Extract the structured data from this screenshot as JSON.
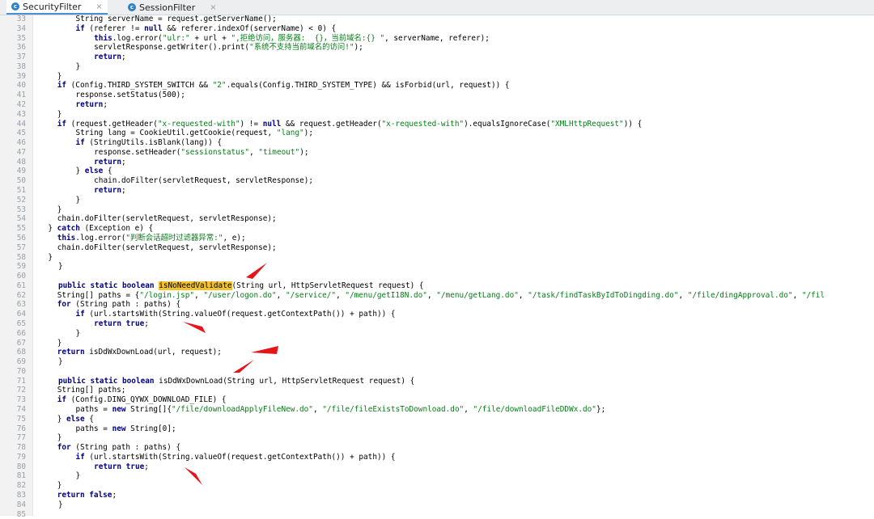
{
  "tabs": [
    {
      "label": "SecurityFilter",
      "icon": "class-icon",
      "close": "×"
    },
    {
      "label": "SessionFilter",
      "icon": "class-icon",
      "close": "×"
    }
  ],
  "lines": [
    {
      "n": "33",
      "i": 8,
      "t": [
        [
          "",
          "String serverName = request.getServerName();"
        ]
      ]
    },
    {
      "n": "34",
      "i": 8,
      "t": [
        [
          "kw",
          "if"
        ],
        [
          "",
          " (referer != "
        ],
        [
          "kw",
          "null"
        ],
        [
          "",
          " && referer.indexOf(serverName) < 0) {"
        ]
      ]
    },
    {
      "n": "35",
      "i": 12,
      "t": [
        [
          "kw",
          "this"
        ],
        [
          "",
          ".log.error("
        ],
        [
          "str",
          "\"ulr:\""
        ],
        [
          "",
          " + url + "
        ],
        [
          "str",
          "\",拒绝访问，服务器:  {}，当前域名:{} \""
        ],
        [
          "",
          ", serverName, referer);"
        ]
      ]
    },
    {
      "n": "36",
      "i": 12,
      "t": [
        [
          "",
          "servletResponse.getWriter().print("
        ],
        [
          "str",
          "\"系统不支持当前域名的访问!\""
        ],
        [
          "",
          ");"
        ]
      ]
    },
    {
      "n": "37",
      "i": 12,
      "t": [
        [
          "kw",
          "return"
        ],
        [
          "",
          ";"
        ]
      ]
    },
    {
      "n": "38",
      "i": 8,
      "t": [
        [
          "",
          "}"
        ]
      ]
    },
    {
      "n": "39",
      "i": 4,
      "t": [
        [
          "",
          "}"
        ]
      ]
    },
    {
      "n": "40",
      "i": 4,
      "t": [
        [
          "kw",
          "if"
        ],
        [
          "",
          " (Config.THIRD_SYSTEM_SWITCH && "
        ],
        [
          "str",
          "\"2\""
        ],
        [
          "",
          ".equals(Config.THIRD_SYSTEM_TYPE) && isForbid(url, request)) {"
        ]
      ]
    },
    {
      "n": "41",
      "i": 8,
      "t": [
        [
          "",
          "response.setStatus(500);"
        ]
      ]
    },
    {
      "n": "42",
      "i": 8,
      "t": [
        [
          "kw",
          "return"
        ],
        [
          "",
          ";"
        ]
      ]
    },
    {
      "n": "43",
      "i": 4,
      "t": [
        [
          "",
          "}"
        ]
      ]
    },
    {
      "n": "44",
      "i": 4,
      "t": [
        [
          "kw",
          "if"
        ],
        [
          "",
          " (request.getHeader("
        ],
        [
          "str",
          "\"x-requested-with\""
        ],
        [
          "",
          ") != "
        ],
        [
          "kw",
          "null"
        ],
        [
          "",
          " && request.getHeader("
        ],
        [
          "str",
          "\"x-requested-with\""
        ],
        [
          "",
          ").equalsIgnoreCase("
        ],
        [
          "str",
          "\"XMLHttpRequest\""
        ],
        [
          "",
          ")) {"
        ]
      ]
    },
    {
      "n": "45",
      "i": 8,
      "t": [
        [
          "",
          "String lang = CookieUtil.getCookie(request, "
        ],
        [
          "str",
          "\"lang\""
        ],
        [
          "",
          ");"
        ]
      ]
    },
    {
      "n": "46",
      "i": 8,
      "t": [
        [
          "kw",
          "if"
        ],
        [
          "",
          " (StringUtils.isBlank(lang)) {"
        ]
      ]
    },
    {
      "n": "47",
      "i": 12,
      "t": [
        [
          "",
          "response.setHeader("
        ],
        [
          "str",
          "\"sessionstatus\""
        ],
        [
          "",
          ", "
        ],
        [
          "str",
          "\"timeout\""
        ],
        [
          "",
          ");"
        ]
      ]
    },
    {
      "n": "48",
      "i": 12,
      "t": [
        [
          "kw",
          "return"
        ],
        [
          "",
          ";"
        ]
      ]
    },
    {
      "n": "49",
      "i": 8,
      "t": [
        [
          "",
          "} "
        ],
        [
          "kw",
          "else"
        ],
        [
          "",
          " {"
        ]
      ]
    },
    {
      "n": "50",
      "i": 12,
      "t": [
        [
          "",
          "chain.doFilter(servletRequest, servletResponse);"
        ]
      ]
    },
    {
      "n": "51",
      "i": 12,
      "t": [
        [
          "kw",
          "return"
        ],
        [
          "",
          ";"
        ]
      ]
    },
    {
      "n": "52",
      "i": 8,
      "t": [
        [
          "",
          "}"
        ]
      ]
    },
    {
      "n": "53",
      "i": 4,
      "t": [
        [
          "",
          "}"
        ]
      ]
    },
    {
      "n": "54",
      "i": 4,
      "t": [
        [
          "",
          "chain.doFilter(servletRequest, servletResponse);"
        ]
      ]
    },
    {
      "n": "55",
      "i": 2,
      "t": [
        [
          "",
          "} "
        ],
        [
          "kw",
          "catch"
        ],
        [
          "",
          " (Exception e) {"
        ]
      ]
    },
    {
      "n": "56",
      "i": 4,
      "t": [
        [
          "kw",
          "this"
        ],
        [
          "",
          ".log.error("
        ],
        [
          "str",
          "\"判断会话超时过滤器异常:\""
        ],
        [
          "",
          ", e);"
        ]
      ]
    },
    {
      "n": "57",
      "i": 4,
      "t": [
        [
          "",
          "chain.doFilter(servletRequest, servletResponse);"
        ]
      ]
    },
    {
      "n": "58",
      "i": 2,
      "t": [
        [
          "",
          "}"
        ]
      ]
    },
    {
      "n": "59",
      "i": 0,
      "t": [
        [
          "",
          "}"
        ]
      ]
    },
    {
      "n": "60",
      "i": 0,
      "t": []
    },
    {
      "n": "61",
      "i": 0,
      "t": [
        [
          "kw",
          "public static boolean"
        ],
        [
          "",
          " "
        ],
        [
          "hl",
          "isNoNeedValidate"
        ],
        [
          "",
          "(String url, HttpServletRequest request) {"
        ]
      ]
    },
    {
      "n": "62",
      "i": 4,
      "t": [
        [
          "",
          "String[] paths = {"
        ],
        [
          "str",
          "\"/login.jsp\""
        ],
        [
          "",
          ", "
        ],
        [
          "str",
          "\"/user/logon.do\""
        ],
        [
          "",
          ", "
        ],
        [
          "str",
          "\"/service/\""
        ],
        [
          "",
          ", "
        ],
        [
          "str",
          "\"/menu/getI18N.do\""
        ],
        [
          "",
          ", "
        ],
        [
          "str",
          "\"/menu/getLang.do\""
        ],
        [
          "",
          ", "
        ],
        [
          "str",
          "\"/task/findTaskByIdToDingding.do\""
        ],
        [
          "",
          ", "
        ],
        [
          "str",
          "\"/file/dingApproval.do\""
        ],
        [
          "",
          ", "
        ],
        [
          "str",
          "\"/fil"
        ]
      ]
    },
    {
      "n": "63",
      "i": 4,
      "t": [
        [
          "kw",
          "for"
        ],
        [
          "",
          " (String path : paths) {"
        ]
      ]
    },
    {
      "n": "64",
      "i": 8,
      "t": [
        [
          "kw",
          "if"
        ],
        [
          "",
          " (url.startsWith(String.valueOf(request.getContextPath()) + path)) {"
        ]
      ]
    },
    {
      "n": "65",
      "i": 12,
      "t": [
        [
          "kw",
          "return true"
        ],
        [
          "",
          ";"
        ]
      ]
    },
    {
      "n": "66",
      "i": 8,
      "t": [
        [
          "",
          "}"
        ]
      ]
    },
    {
      "n": "67",
      "i": 4,
      "t": [
        [
          "",
          "}"
        ]
      ]
    },
    {
      "n": "68",
      "i": 4,
      "t": [
        [
          "kw",
          "return"
        ],
        [
          "",
          " isDdWxDownLoad(url, request);"
        ]
      ]
    },
    {
      "n": "69",
      "i": 0,
      "t": [
        [
          "",
          "}"
        ]
      ]
    },
    {
      "n": "70",
      "i": 0,
      "t": []
    },
    {
      "n": "71",
      "i": 0,
      "t": [
        [
          "kw",
          "public static boolean"
        ],
        [
          "",
          " isDdWxDownLoad(String url, HttpServletRequest request) {"
        ]
      ]
    },
    {
      "n": "72",
      "i": 4,
      "t": [
        [
          "",
          "String[] paths;"
        ]
      ]
    },
    {
      "n": "73",
      "i": 4,
      "t": [
        [
          "kw",
          "if"
        ],
        [
          "",
          " (Config.DING_QYWX_DOWNLOAD_FILE) {"
        ]
      ]
    },
    {
      "n": "74",
      "i": 8,
      "t": [
        [
          "",
          "paths = "
        ],
        [
          "kw",
          "new"
        ],
        [
          "",
          " String[]{"
        ],
        [
          "str",
          "\"/file/downloadApplyFileNew.do\""
        ],
        [
          "",
          ", "
        ],
        [
          "str",
          "\"/file/fileExistsToDownload.do\""
        ],
        [
          "",
          ", "
        ],
        [
          "str",
          "\"/file/downloadFileDDWx.do\""
        ],
        [
          "",
          "};"
        ]
      ]
    },
    {
      "n": "75",
      "i": 4,
      "t": [
        [
          "",
          "} "
        ],
        [
          "kw",
          "else"
        ],
        [
          "",
          " {"
        ]
      ]
    },
    {
      "n": "76",
      "i": 8,
      "t": [
        [
          "",
          "paths = "
        ],
        [
          "kw",
          "new"
        ],
        [
          "",
          " String[0];"
        ]
      ]
    },
    {
      "n": "77",
      "i": 4,
      "t": [
        [
          "",
          "}"
        ]
      ]
    },
    {
      "n": "78",
      "i": 4,
      "t": [
        [
          "kw",
          "for"
        ],
        [
          "",
          " (String path : paths) {"
        ]
      ]
    },
    {
      "n": "79",
      "i": 8,
      "t": [
        [
          "kw",
          "if"
        ],
        [
          "",
          " (url.startsWith(String.valueOf(request.getContextPath()) + path)) {"
        ]
      ]
    },
    {
      "n": "80",
      "i": 12,
      "t": [
        [
          "kw",
          "return true"
        ],
        [
          "",
          ";"
        ]
      ]
    },
    {
      "n": "81",
      "i": 8,
      "t": [
        [
          "",
          "}"
        ]
      ]
    },
    {
      "n": "82",
      "i": 4,
      "t": [
        [
          "",
          "}"
        ]
      ]
    },
    {
      "n": "83",
      "i": 4,
      "t": [
        [
          "kw",
          "return false"
        ],
        [
          "",
          ";"
        ]
      ]
    },
    {
      "n": "84",
      "i": 0,
      "t": [
        [
          "",
          "}"
        ]
      ]
    },
    {
      "n": "85",
      "i": 0,
      "t": []
    }
  ],
  "colors": {
    "keyword": "#000080",
    "string": "#067d17",
    "highlight": "#f2c230",
    "annotation_arrow": "#e8141b"
  },
  "annotations": [
    {
      "icon": "red-arrow-icon"
    },
    {
      "icon": "red-arrow-icon"
    },
    {
      "icon": "red-arrow-icon"
    },
    {
      "icon": "red-arrow-icon"
    },
    {
      "icon": "red-arrow-icon"
    }
  ]
}
